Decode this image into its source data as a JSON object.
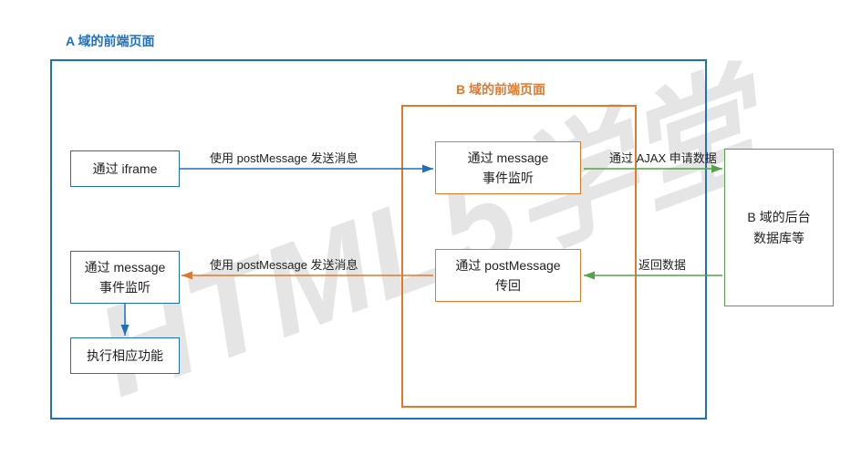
{
  "watermark": "HTML5学堂",
  "titles": {
    "domainA": "A 域的前端页面",
    "domainB": "B 域的前端页面"
  },
  "boxes": {
    "a_iframe": "通过 iframe",
    "a_message_listen_l1": "通过 message",
    "a_message_listen_l2": "事件监听",
    "a_exec": "执行相应功能",
    "b_message_listen_l1": "通过 message",
    "b_message_listen_l2": "事件监听",
    "b_post_back_l1": "通过 postMessage",
    "b_post_back_l2": "传回",
    "b_backend_l1": "B 域的后台",
    "b_backend_l2": "数据库等"
  },
  "arrowLabels": {
    "a_to_b_send": "使用 postMessage 发送消息",
    "b_to_a_send": "使用 postMessage 发送消息",
    "b_to_backend": "通过 AJAX 申请数据",
    "backend_to_b": "返回数据"
  },
  "colors": {
    "blue": "#1f6fc0",
    "orange": "#e1782c",
    "green": "#52a447"
  }
}
